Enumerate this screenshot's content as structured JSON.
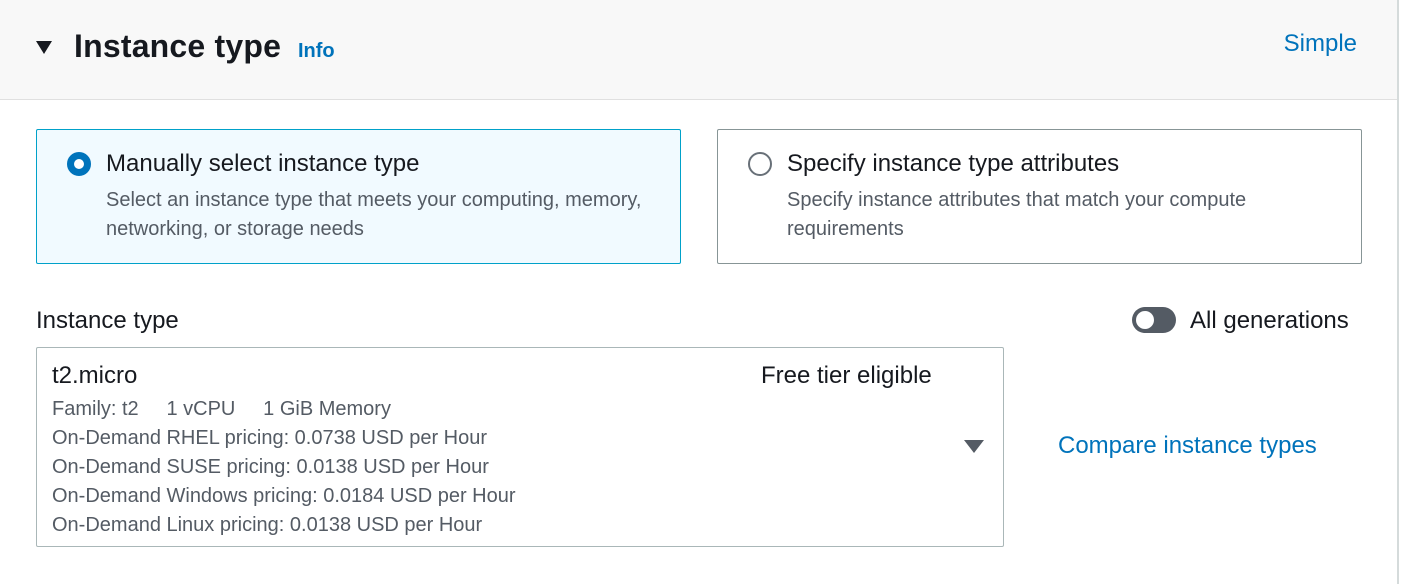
{
  "header": {
    "title": "Instance type",
    "info_label": "Info",
    "simple_label": "Simple"
  },
  "tiles": {
    "manual": {
      "title": "Manually select instance type",
      "description": "Select an instance type that meets your computing, memory, networking, or storage needs",
      "selected": true
    },
    "attributes": {
      "title": "Specify instance type attributes",
      "description": "Specify instance attributes that match your compute requirements",
      "selected": false
    }
  },
  "field": {
    "label": "Instance type",
    "toggle_label": "All generations",
    "toggle_on": false
  },
  "select": {
    "name": "t2.micro",
    "badge": "Free tier eligible",
    "details": "Family: t2     1 vCPU     1 GiB Memory",
    "pricing": [
      "On-Demand RHEL pricing: 0.0738 USD per Hour",
      "On-Demand SUSE pricing: 0.0138 USD per Hour",
      "On-Demand Windows pricing: 0.0184 USD per Hour",
      "On-Demand Linux pricing: 0.0138 USD per Hour"
    ]
  },
  "compare_label": "Compare instance types",
  "colors": {
    "link": "#0073bb",
    "selected_border": "#00a1c9",
    "selected_bg": "#f1faff",
    "text": "#16191f",
    "secondary_text": "#545b64"
  }
}
